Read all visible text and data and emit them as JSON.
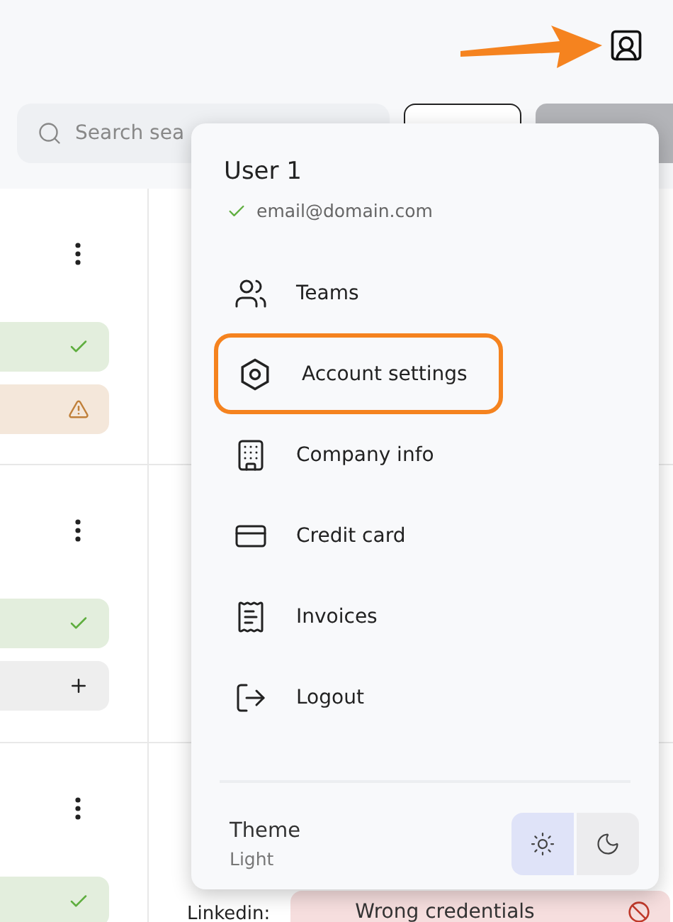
{
  "search": {
    "placeholder": "Search sea"
  },
  "rows": [
    {
      "statuses": [
        {
          "kind": "ok"
        },
        {
          "kind": "warning"
        }
      ]
    },
    {
      "statuses": [
        {
          "kind": "ok"
        },
        {
          "kind": "add"
        }
      ]
    },
    {
      "statuses": [
        {
          "kind": "ok"
        }
      ],
      "channel": {
        "label": "Linkedin:",
        "status": "Wrong credentials",
        "kind": "error"
      }
    }
  ],
  "menu": {
    "user": "User 1",
    "email": "email@domain.com",
    "verified": true,
    "items": [
      {
        "label": "Teams",
        "kind": "teams",
        "highlighted": false
      },
      {
        "label": "Account settings",
        "kind": "settings",
        "highlighted": true
      },
      {
        "label": "Company info",
        "kind": "company",
        "highlighted": false
      },
      {
        "label": "Credit card",
        "kind": "card",
        "highlighted": false
      },
      {
        "label": "Invoices",
        "kind": "invoice",
        "highlighted": false
      },
      {
        "label": "Logout",
        "kind": "logout",
        "highlighted": false
      }
    ],
    "theme": {
      "label": "Theme",
      "value": "Light",
      "options": [
        {
          "kind": "light",
          "selected": true
        },
        {
          "kind": "dark",
          "selected": false
        }
      ]
    }
  }
}
